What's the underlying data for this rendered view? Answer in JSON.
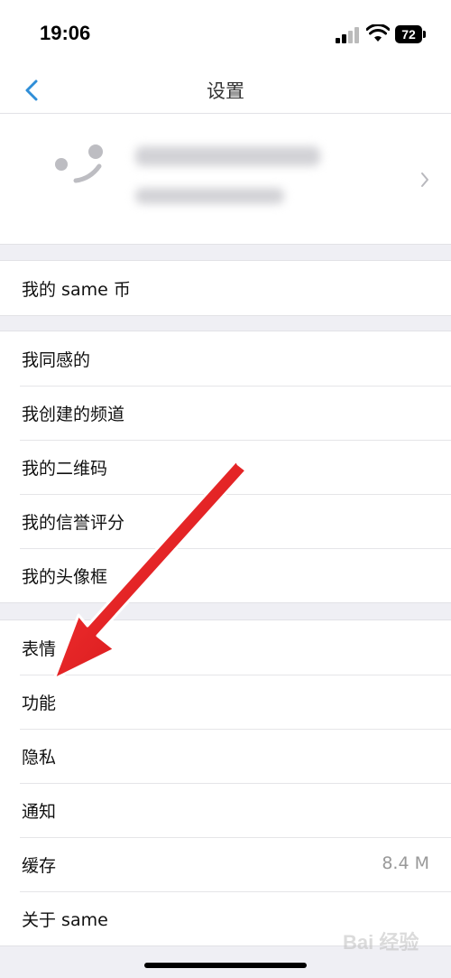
{
  "status": {
    "time": "19:06",
    "battery": "72"
  },
  "nav": {
    "title": "设置"
  },
  "groups": {
    "coins": {
      "items": [
        {
          "label": "我的 same 币"
        }
      ]
    },
    "mine": {
      "items": [
        {
          "label": "我同感的"
        },
        {
          "label": "我创建的频道"
        },
        {
          "label": "我的二维码"
        },
        {
          "label": "我的信誉评分"
        },
        {
          "label": "我的头像框"
        }
      ]
    },
    "settings": {
      "items": [
        {
          "label": "表情"
        },
        {
          "label": "功能"
        },
        {
          "label": "隐私"
        },
        {
          "label": "通知"
        },
        {
          "label": "缓存",
          "value": "8.4 M"
        },
        {
          "label": "关于 same"
        }
      ]
    }
  },
  "watermark": "Bai 经验",
  "colors": {
    "accent": "#2f8ed8",
    "arrow": "#e0181b"
  }
}
